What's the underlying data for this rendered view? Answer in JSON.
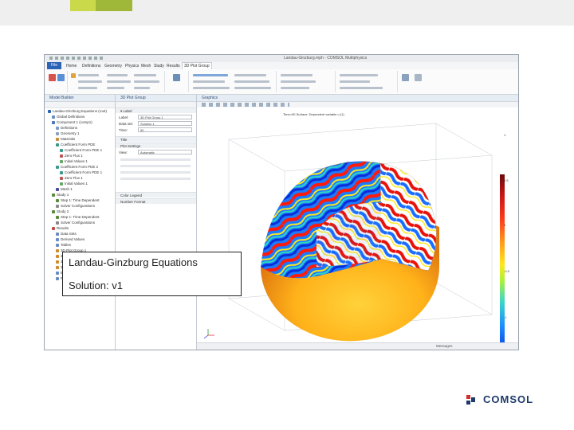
{
  "window": {
    "title": "Landau-Ginzburg.mph - COMSOL Multiphysics"
  },
  "ribbon_tabs": [
    "File",
    "Home",
    "Definitions",
    "Geometry",
    "Physics",
    "Mesh",
    "Study",
    "Results",
    "3D Plot Group"
  ],
  "active_tab": "3D Plot Group",
  "model_builder": {
    "title": "Model Builder",
    "tree": [
      "Landau-Ginzburg Equations (root)",
      "Global Definitions",
      "Component 1 (comp1)",
      "Definitions",
      "Geometry 1",
      "Materials",
      "Coefficient Form PDE",
      "Coefficient Form PDE 1",
      "Zero Flux 1",
      "Initial Values 1",
      "Coefficient Form PDE 2",
      "Coefficient Form PDE 1",
      "Zero Flux 1",
      "Initial Values 1",
      "Mesh 1",
      "Study 1",
      "Step 1: Time Dependent",
      "Solver Configurations",
      "Study 2",
      "Step 1: Time Dependent",
      "Solver Configurations",
      "Results",
      "Data Sets",
      "Derived Values",
      "Tables",
      "3D Plot Group 1",
      "3D Plot Group 2",
      "3D Plot Group 3",
      "3D Plot Group 4",
      "Export",
      "Reports"
    ]
  },
  "settings": {
    "title": "3D Plot Group",
    "plot_label": "Plot",
    "label_caption": "Label:",
    "label_value": "3D Plot Group 1",
    "data_set_caption": "Data set:",
    "data_set_value": "Solution 1",
    "time_caption": "Time:",
    "time_value": "50",
    "title_section": "Title",
    "plot_settings_section": "Plot Settings",
    "view_caption": "View:",
    "view_value": "Automatic",
    "color_legend_section": "Color Legend",
    "number_format_section": "Number Format"
  },
  "graphics": {
    "title": "Graphics",
    "plot_title": "Time=50 Surface: Dependent variable u (1)",
    "status_text": "Messages"
  },
  "colorbar": {
    "ticks": [
      "1",
      "0.5",
      "0",
      "-0.5",
      "-1"
    ],
    "top_marker": "▲ 1",
    "bottom_marker": "▼ -1"
  },
  "caption": {
    "line1": "Landau-Ginzburg Equations",
    "line2": "Solution: v1"
  },
  "logo": {
    "text": "COMSOL"
  },
  "colors": {
    "accent": "#2b63b5",
    "logo": "#1e3a6b",
    "logo_red": "#d32f2f"
  }
}
